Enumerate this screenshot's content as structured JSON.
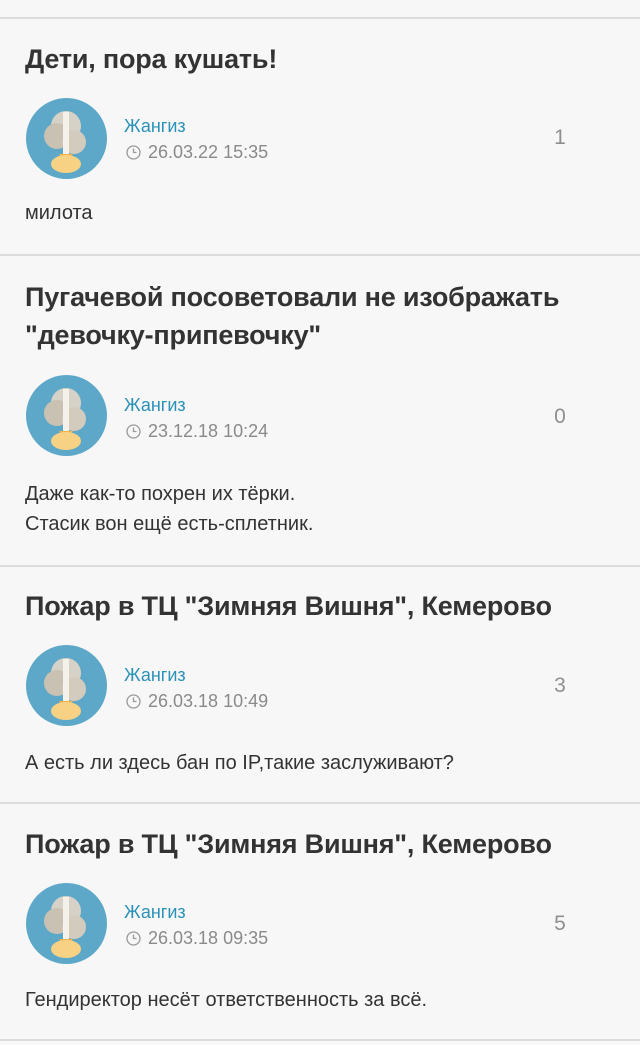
{
  "posts": [
    {
      "title": "Дети, пора кушать!",
      "author": "Жангиз",
      "timestamp": "26.03.22 15:35",
      "count": "1",
      "body": [
        "милота"
      ]
    },
    {
      "title": "Пугачевой посоветовали не изображать \"девочку-припевочку\"",
      "author": "Жангиз",
      "timestamp": "23.12.18 10:24",
      "count": "0",
      "body": [
        "Даже как-то похрен их тёрки.",
        "Стасик вон ещё есть-сплетник."
      ]
    },
    {
      "title": "Пожар в ТЦ \"Зимняя Вишня\", Кемерово",
      "author": "Жангиз",
      "timestamp": "26.03.18 10:49",
      "count": "3",
      "body": [
        "А есть ли здесь бан по IP,такие заслуживают?"
      ]
    },
    {
      "title": "Пожар в ТЦ \"Зимняя Вишня\", Кемерово",
      "author": "Жангиз",
      "timestamp": "26.03.18 09:35",
      "count": "5",
      "body": [
        "Гендиректор несёт ответственность за всё."
      ]
    }
  ],
  "icons": {
    "timestamp": "clock-icon",
    "avatar": "rocket-launch-photo"
  },
  "colors": {
    "background": "#f7f7f7",
    "title": "#333333",
    "author_link": "#2a91b8",
    "meta": "#8a8a8a",
    "count": "#8f8f8f",
    "divider": "#dcdcdc"
  }
}
